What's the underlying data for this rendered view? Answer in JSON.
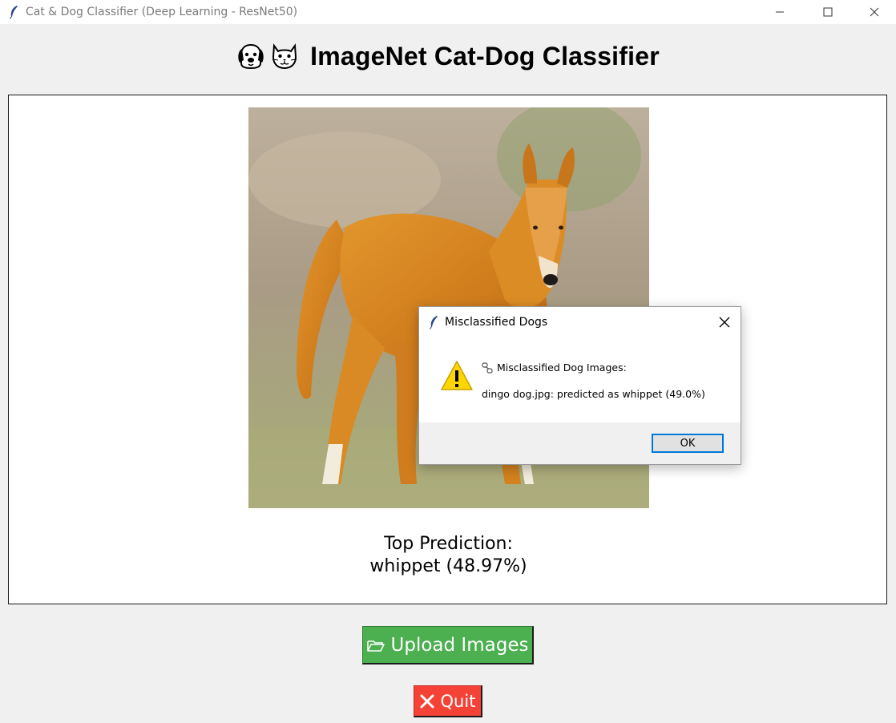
{
  "window": {
    "title": "Cat & Dog Classifier (Deep Learning - ResNet50)"
  },
  "header": {
    "emoji_icons": [
      "dog-face-icon",
      "cat-face-icon"
    ],
    "title": "ImageNet Cat-Dog Classifier"
  },
  "main": {
    "image_subject": "dingo",
    "prediction_label": "Top Prediction:",
    "prediction_value": "whippet (48.97%)"
  },
  "buttons": {
    "upload_label": "Upload Images",
    "upload_color": "#4caf50",
    "quit_label": "Quit",
    "quit_color": "#f44336"
  },
  "dialog": {
    "title": "Misclassified Dogs",
    "heading": "Misclassified Dog Images:",
    "message": "dingo dog.jpg: predicted as whippet (49.0%)",
    "ok_label": "OK",
    "accent": "#0078d7"
  }
}
